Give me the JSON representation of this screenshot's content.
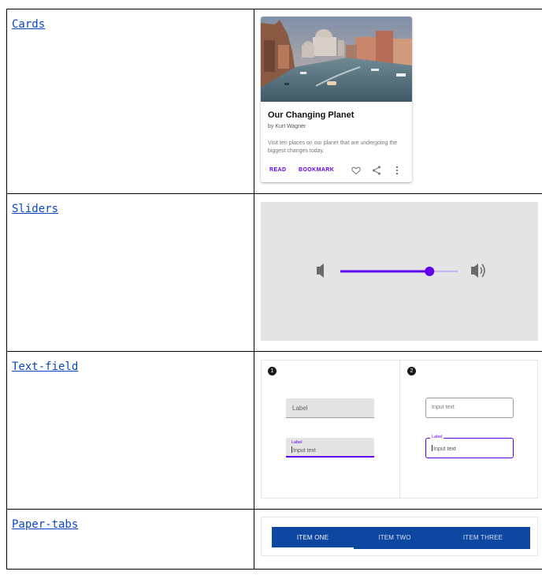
{
  "rows": [
    {
      "name": "Cards"
    },
    {
      "name": "Sliders"
    },
    {
      "name": "Text-field"
    },
    {
      "name": "Paper-tabs"
    }
  ],
  "card": {
    "title": "Our Changing Planet",
    "subtitle": "by Kurt Wagner",
    "body": "Visit ten places on our planet that are undergoing the biggest changes today.",
    "actions": [
      "READ",
      "BOOKMARK"
    ],
    "icons": [
      "heart-icon",
      "share-icon",
      "more-vert-icon"
    ],
    "accent": "#6200ee"
  },
  "slider": {
    "value_fraction": 0.76,
    "icons": [
      "volume-low-icon",
      "volume-high-icon"
    ],
    "track_color": "#6200ee",
    "inactive_track_color": "#c9b1f5"
  },
  "textfield": {
    "badges": [
      "1",
      "2"
    ],
    "filled_label": "Label",
    "filled_focused_label": "Label",
    "filled_focused_value": "Input text",
    "outlined_placeholder": "Input text",
    "outlined_focused_label": "Label",
    "outlined_focused_value": "Input text"
  },
  "tabs": {
    "items": [
      "ITEM ONE",
      "ITEM TWO",
      "ITEM THREE"
    ],
    "active_index": 0,
    "bar_color": "#0d47a1"
  }
}
